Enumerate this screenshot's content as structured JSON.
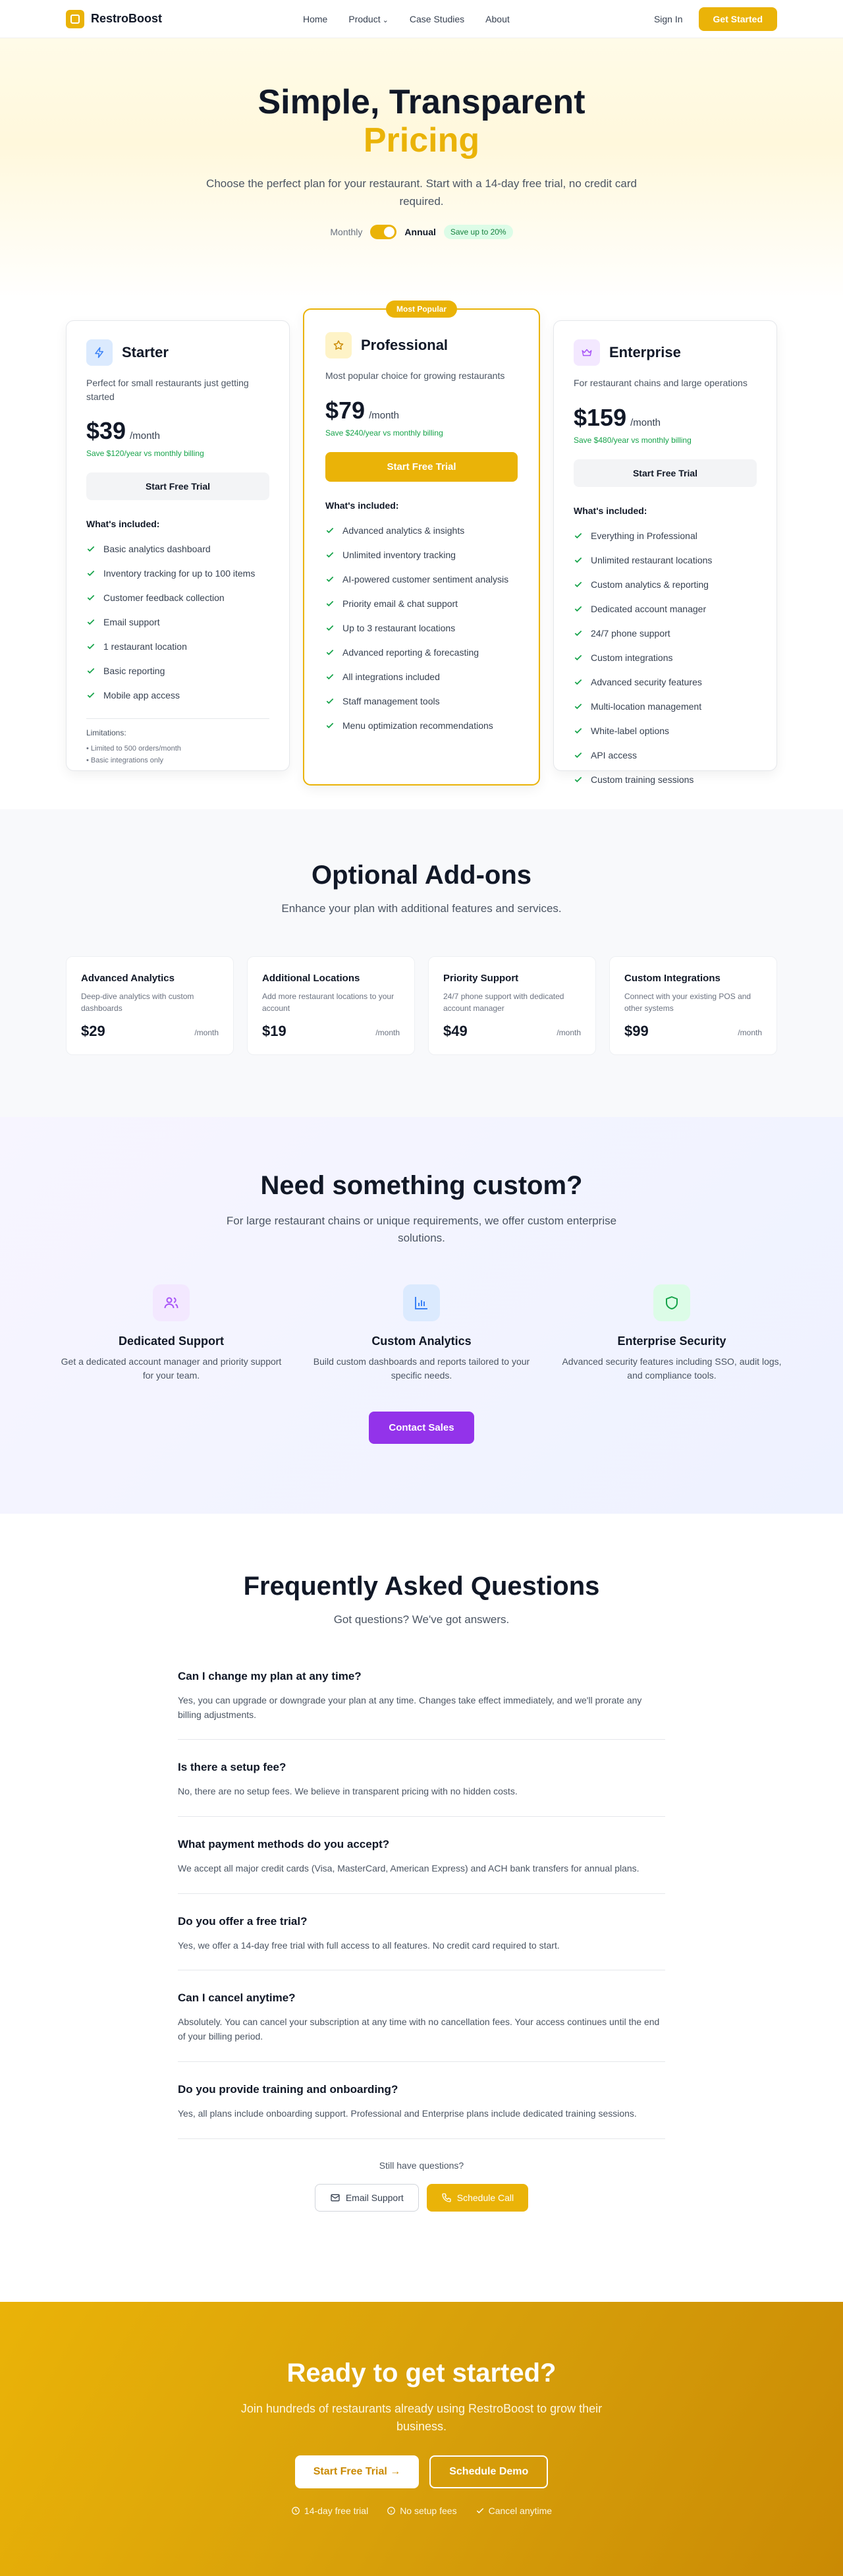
{
  "nav": {
    "brand": "RestroBoost",
    "links": [
      "Home",
      "Product",
      "Case Studies",
      "About"
    ],
    "sign_in": "Sign In",
    "cta": "Get Started"
  },
  "hero": {
    "title_line1": "Simple, Transparent",
    "title_line2": "Pricing",
    "subtitle": "Choose the perfect plan for your restaurant. Start with a 14-day free trial, no credit card required.",
    "billing_monthly": "Monthly",
    "billing_annual": "Annual",
    "save_badge": "Save up to 20%"
  },
  "plans": [
    {
      "name": "Starter",
      "description": "Perfect for small restaurants just getting started",
      "price": "$39",
      "period": "/month",
      "savings": "Save $120/year vs monthly billing",
      "button": "Start Free Trial",
      "included_label": "What's included:",
      "features": [
        "Basic analytics dashboard",
        "Inventory tracking for up to 100 items",
        "Customer feedback collection",
        "Email support",
        "1 restaurant location",
        "Basic reporting",
        "Mobile app access"
      ],
      "limitations_label": "Limitations:",
      "limitations": [
        "• Limited to 500 orders/month",
        "• Basic integrations only"
      ]
    },
    {
      "name": "Professional",
      "badge": "Most Popular",
      "description": "Most popular choice for growing restaurants",
      "price": "$79",
      "period": "/month",
      "savings": "Save $240/year vs monthly billing",
      "button": "Start Free Trial",
      "included_label": "What's included:",
      "features": [
        "Advanced analytics & insights",
        "Unlimited inventory tracking",
        "AI-powered customer sentiment analysis",
        "Priority email & chat support",
        "Up to 3 restaurant locations",
        "Advanced reporting & forecasting",
        "All integrations included",
        "Staff management tools",
        "Menu optimization recommendations"
      ]
    },
    {
      "name": "Enterprise",
      "description": "For restaurant chains and large operations",
      "price": "$159",
      "period": "/month",
      "savings": "Save $480/year vs monthly billing",
      "button": "Start Free Trial",
      "included_label": "What's included:",
      "features": [
        "Everything in Professional",
        "Unlimited restaurant locations",
        "Custom analytics & reporting",
        "Dedicated account manager",
        "24/7 phone support",
        "Custom integrations",
        "Advanced security features",
        "Multi-location management",
        "White-label options",
        "API access",
        "Custom training sessions"
      ]
    }
  ],
  "addons": {
    "title": "Optional Add-ons",
    "subtitle": "Enhance your plan with additional features and services.",
    "items": [
      {
        "name": "Advanced Analytics",
        "desc": "Deep-dive analytics with custom dashboards",
        "price": "$29",
        "period": "/month"
      },
      {
        "name": "Additional Locations",
        "desc": "Add more restaurant locations to your account",
        "price": "$19",
        "period": "/month"
      },
      {
        "name": "Priority Support",
        "desc": "24/7 phone support with dedicated account manager",
        "price": "$49",
        "period": "/month"
      },
      {
        "name": "Custom Integrations",
        "desc": "Connect with your existing POS and other systems",
        "price": "$99",
        "period": "/month"
      }
    ]
  },
  "custom": {
    "title": "Need something custom?",
    "subtitle": "For large restaurant chains or unique requirements, we offer custom enterprise solutions.",
    "items": [
      {
        "title": "Dedicated Support",
        "desc": "Get a dedicated account manager and priority support for your team."
      },
      {
        "title": "Custom Analytics",
        "desc": "Build custom dashboards and reports tailored to your specific needs."
      },
      {
        "title": "Enterprise Security",
        "desc": "Advanced security features including SSO, audit logs, and compliance tools."
      }
    ],
    "button": "Contact Sales"
  },
  "faq": {
    "title": "Frequently Asked Questions",
    "subtitle": "Got questions? We've got answers.",
    "items": [
      {
        "q": "Can I change my plan at any time?",
        "a": "Yes, you can upgrade or downgrade your plan at any time. Changes take effect immediately, and we'll prorate any billing adjustments."
      },
      {
        "q": "Is there a setup fee?",
        "a": "No, there are no setup fees. We believe in transparent pricing with no hidden costs."
      },
      {
        "q": "What payment methods do you accept?",
        "a": "We accept all major credit cards (Visa, MasterCard, American Express) and ACH bank transfers for annual plans."
      },
      {
        "q": "Do you offer a free trial?",
        "a": "Yes, we offer a 14-day free trial with full access to all features. No credit card required to start."
      },
      {
        "q": "Can I cancel anytime?",
        "a": "Absolutely. You can cancel your subscription at any time with no cancellation fees. Your access continues until the end of your billing period."
      },
      {
        "q": "Do you provide training and onboarding?",
        "a": "Yes, all plans include onboarding support. Professional and Enterprise plans include dedicated training sessions."
      }
    ],
    "still": "Still have questions?",
    "email_btn": "Email Support",
    "call_btn": "Schedule Call"
  },
  "cta": {
    "title": "Ready to get started?",
    "subtitle": "Join hundreds of restaurants already using RestroBoost to grow their business.",
    "primary": "Start Free Trial",
    "secondary": "Schedule Demo",
    "notes": [
      "14-day free trial",
      "No setup fees",
      "Cancel anytime"
    ]
  },
  "colors": {
    "accent": "#eab308",
    "purple": "#9333ea",
    "green": "#16a34a"
  }
}
